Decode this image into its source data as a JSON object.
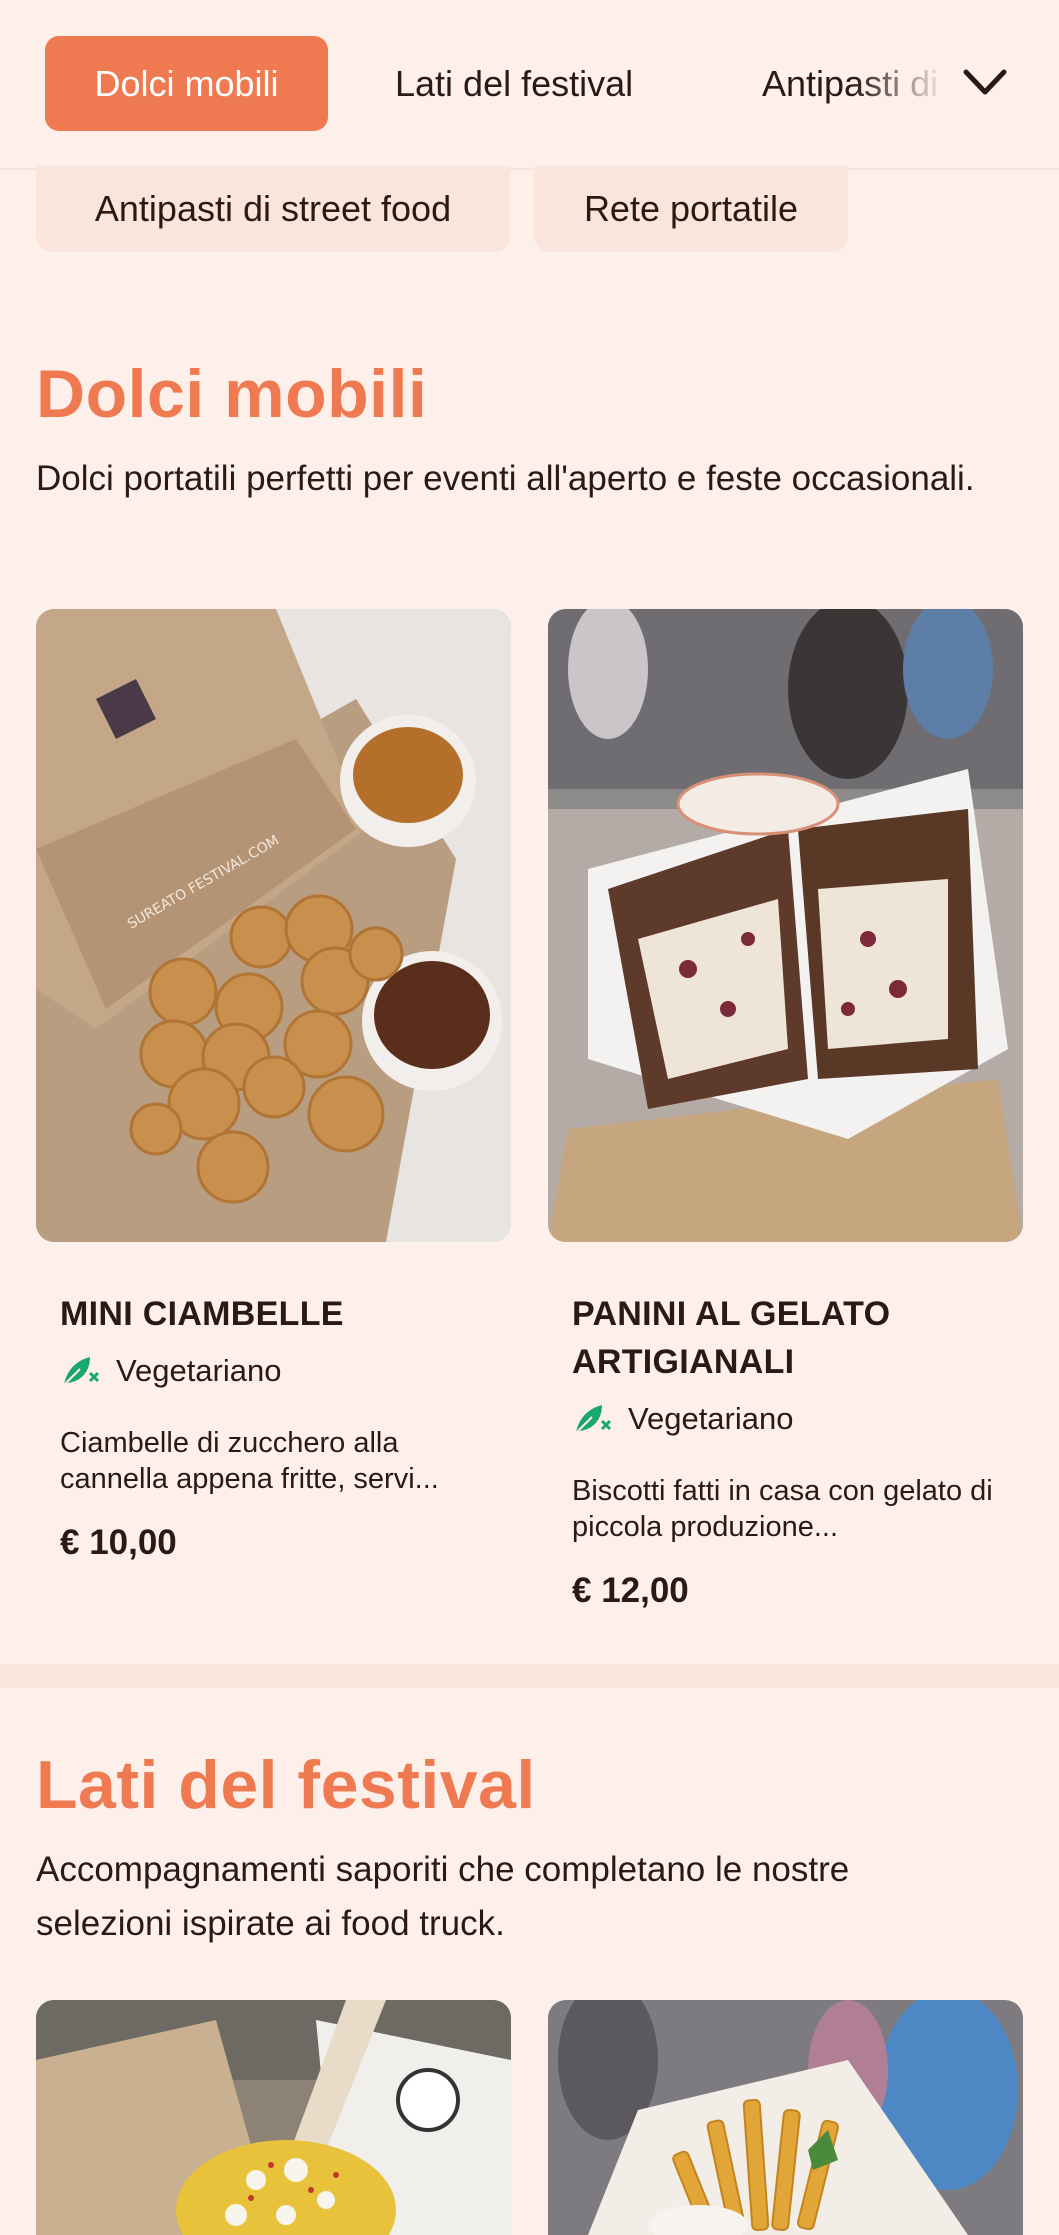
{
  "nav": {
    "tabs": [
      {
        "label": "Dolci mobili"
      },
      {
        "label": "Lati del festival"
      },
      {
        "label": "Antipasti di street food"
      },
      {
        "label": "Rete portatile"
      }
    ]
  },
  "sections": [
    {
      "title": "Dolci mobili",
      "description": "Dolci portatili perfetti per eventi all'aperto e feste occasionali.",
      "items": [
        {
          "name": "MINI CIAMBELLE",
          "tag": "Vegetariano",
          "description": "Ciambelle di zucchero alla cannella appena fritte, servi...",
          "price": "€ 10,00",
          "image": "mini-donuts-image"
        },
        {
          "name": "PANINI AL GELATO ARTIGIANALI",
          "tag": "Vegetariano",
          "description": "Biscotti fatti in casa con gelato di piccola produzione...",
          "price": "€ 12,00",
          "image": "ice-cream-sandwich-image"
        }
      ]
    },
    {
      "title": "Lati del festival",
      "description": "Accompagnamenti saporiti che completano le nostre selezioni ispirate ai food truck.",
      "items": [
        {
          "image": "street-corn-image"
        },
        {
          "image": "loaded-fries-image"
        }
      ]
    }
  ],
  "colors": {
    "accent": "#ef7a52",
    "background": "#fdf0ea",
    "veg_icon": "#1aa86a"
  }
}
